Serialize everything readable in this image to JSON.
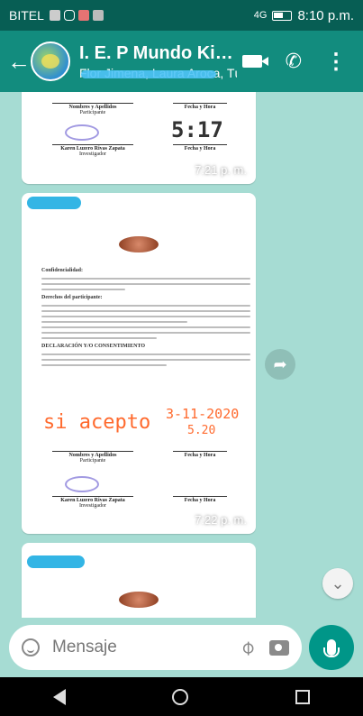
{
  "status_bar": {
    "carrier": "BITEL",
    "network": "4G",
    "time": "8:10 p.m."
  },
  "header": {
    "title": "I. E. P Mundo Kid...",
    "subtitle": "Flor Jimena, Laura Aroca, Tú"
  },
  "messages": [
    {
      "type": "image",
      "time": "7:21 p. m.",
      "doc": {
        "name_label": "Nombres y Apellidos",
        "participant_label": "Participante",
        "date_label": "Fecha y Hora",
        "stamp": "5:17",
        "researcher_name": "Karen Luzero Rivas Zapata",
        "researcher_label": "Investigador"
      }
    },
    {
      "type": "image",
      "time": "7:22 p. m.",
      "doc": {
        "section_confidentiality": "Confidencialidad:",
        "section_rights": "Derechos del participante:",
        "section_declaration": "DECLARACIÓN Y/O CONSENTIMIENTO",
        "handwritten_accept": "si acepto",
        "handwritten_date": "3-11-2020",
        "handwritten_time": "5.20",
        "name_label": "Nombres y Apellidos",
        "participant_label": "Participante",
        "date_label": "Fecha y Hora",
        "researcher_name": "Karen Luzero Rivas Zapata",
        "researcher_label": "Investigador"
      }
    },
    {
      "type": "image",
      "time": ""
    }
  ],
  "composer": {
    "placeholder": "Mensaje"
  },
  "colors": {
    "status_bar": "#075e54",
    "app_bar": "#128c7e",
    "chat_background": "#a6dcd3",
    "mic_button": "#009688",
    "handwriting": "#ff6a2e"
  },
  "icons": [
    "back-arrow-icon",
    "video-call-icon",
    "phone-icon",
    "more-options-icon",
    "share-icon",
    "scroll-down-icon",
    "emoji-icon",
    "attach-icon",
    "camera-icon",
    "mic-icon"
  ]
}
